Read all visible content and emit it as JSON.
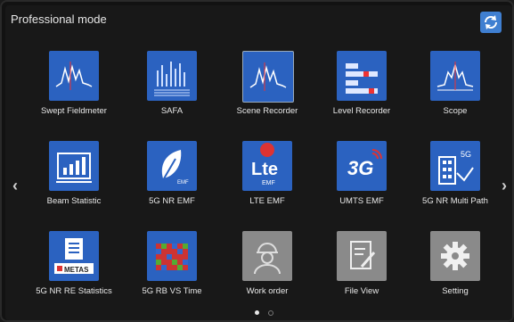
{
  "header": {
    "title": "Professional mode",
    "refresh_icon": "refresh-icon"
  },
  "nav": {
    "prev_icon": "chevron-left-icon",
    "next_icon": "chevron-right-icon"
  },
  "apps": [
    {
      "label": "Swept Fieldmeter",
      "icon": "waveform-icon"
    },
    {
      "label": "SAFA",
      "icon": "spectrum-bars-icon"
    },
    {
      "label": "Scene Recorder",
      "icon": "waveform-icon"
    },
    {
      "label": "Level Recorder",
      "icon": "level-recorder-icon"
    },
    {
      "label": "Scope",
      "icon": "scope-icon"
    },
    {
      "label": "Beam Statistic",
      "icon": "bar-chart-icon"
    },
    {
      "label": "5G NR EMF",
      "icon": "leaf-icon"
    },
    {
      "label": "LTE EMF",
      "icon": "lte-icon"
    },
    {
      "label": "UMTS EMF",
      "icon": "3g-icon"
    },
    {
      "label": "5G NR Multi Path",
      "icon": "building-5g-icon"
    },
    {
      "label": "5G NR RE Statistics",
      "icon": "metas-icon"
    },
    {
      "label": "5G RB VS Time",
      "icon": "heatmap-icon"
    },
    {
      "label": "Work order",
      "icon": "worker-icon"
    },
    {
      "label": "File View",
      "icon": "file-edit-icon"
    },
    {
      "label": "Setting",
      "icon": "gear-icon"
    }
  ],
  "icon_text": {
    "lte": "Lte",
    "lte_sub": "EMF",
    "emf": "EMF",
    "umts": "3G",
    "fiveg": "5G",
    "metas": "METAS"
  },
  "pagination": {
    "pages": 2,
    "current": 1
  },
  "colors": {
    "tile_blue": "#2b62c0",
    "tile_gray": "#8a8a8a",
    "background": "#181818"
  }
}
